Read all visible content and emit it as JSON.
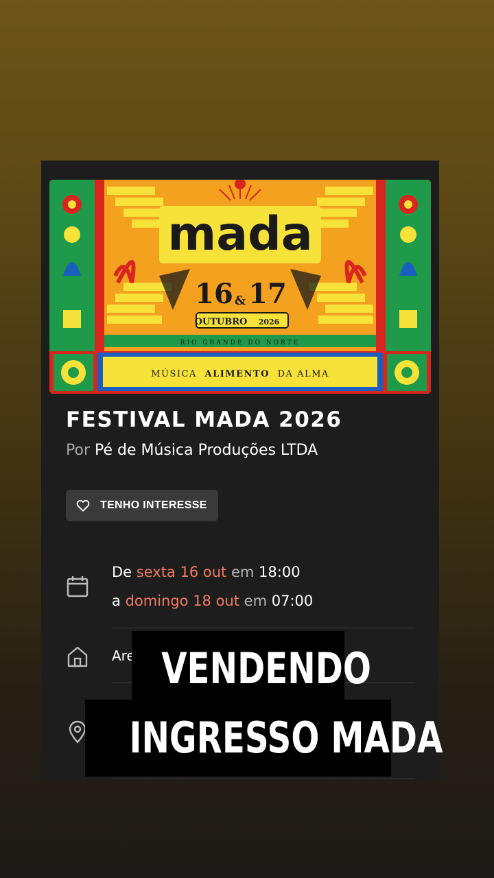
{
  "event": {
    "title": "FESTIVAL MADA 2026",
    "organizer_prefix": "Por",
    "organizer": "Pé de Música Produções LTDA",
    "interest_label": "TENHO INTERESSE"
  },
  "banner": {
    "logo": "mada",
    "day1": "16",
    "amp": "&",
    "day2": "17",
    "month": "OUTUBRO",
    "year": "2026",
    "region": "RIO GRANDE DO NORTE",
    "tagline_1": "MÚSICA",
    "tagline_2": "ALIMENTO",
    "tagline_3": "DA ALMA"
  },
  "dates": {
    "start_prefix": "De",
    "start_day": "sexta 16 out",
    "start_mid": "em",
    "start_time": "18:00",
    "end_prefix": "a",
    "end_day": "domingo 18 out",
    "end_mid": "em",
    "end_time": "07:00"
  },
  "venue": {
    "name_partial": "Are"
  },
  "overlay": {
    "line1": "VENDENDO",
    "line2": "INGRESSO MADA"
  },
  "colors": {
    "accent": "#f07a63",
    "card_bg": "#1d1d1d",
    "button_bg": "#3a3a3a"
  },
  "icons": [
    "heart-icon",
    "calendar-icon",
    "home-icon",
    "location-pin-icon"
  ]
}
